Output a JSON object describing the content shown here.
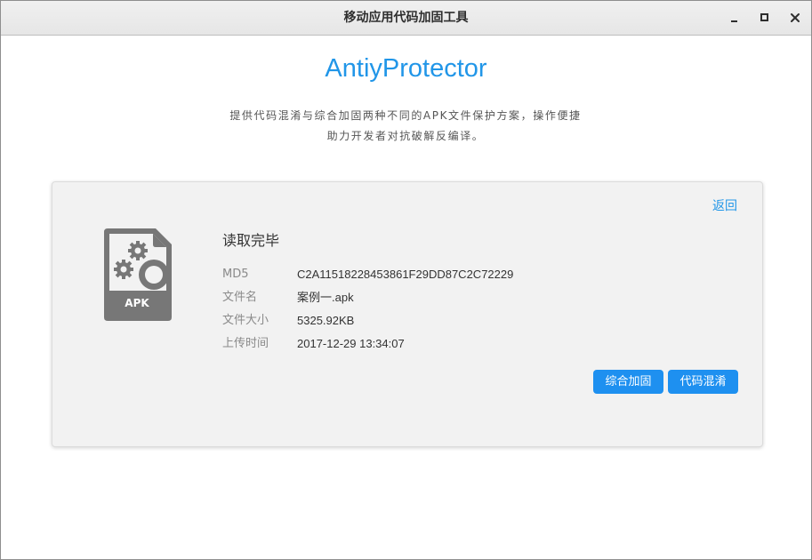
{
  "window": {
    "title": "移动应用代码加固工具",
    "controls": {
      "minimize": "minimize-icon",
      "maximize": "maximize-icon",
      "close": "close-icon"
    }
  },
  "header": {
    "app_name": "AntiyProtector",
    "description_line1": "提供代码混淆与综合加固两种不同的APK文件保护方案，操作便捷",
    "description_line2": "助力开发者对抗破解反编译。"
  },
  "card": {
    "back_label": "返回",
    "file_icon": {
      "name": "apk-file-icon",
      "label": "APK",
      "color": "#777777"
    },
    "status": "读取完毕",
    "info": [
      {
        "label": "MD5",
        "value": "C2A11518228453861F29DD87C2C72229"
      },
      {
        "label": "文件名",
        "value": "案例一.apk"
      },
      {
        "label": "文件大小",
        "value": "5325.92KB"
      },
      {
        "label": "上传时间",
        "value": "2017-12-29 13:34:07"
      }
    ],
    "actions": {
      "protect_label": "综合加固",
      "obfuscate_label": "代码混淆"
    }
  },
  "colors": {
    "accent": "#2196e8",
    "button": "#1e90f0",
    "card_bg": "#f2f2f2",
    "icon_gray": "#777777"
  }
}
